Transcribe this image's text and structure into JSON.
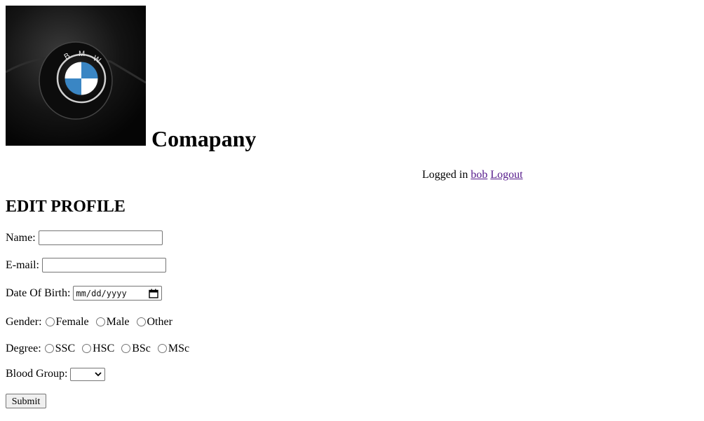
{
  "header": {
    "logo_icon": "bmw-steering-logo",
    "company_name": "Comapany"
  },
  "login": {
    "prefix": "Logged in",
    "username": "bob",
    "logout_label": "Logout"
  },
  "page": {
    "title": "EDIT PROFILE"
  },
  "form": {
    "name_label": "Name:",
    "name_value": "",
    "email_label": "E-mail:",
    "email_value": "",
    "dob_label": "Date Of Birth:",
    "dob_placeholder": "mm/dd/yyyy",
    "gender_label": "Gender:",
    "gender_options": [
      "Female",
      "Male",
      "Other"
    ],
    "degree_label": "Degree:",
    "degree_options": [
      "SSC",
      "HSC",
      "BSc",
      "MSc"
    ],
    "blood_group_label": "Blood Group:",
    "blood_group_value": "",
    "submit_label": "Submit"
  },
  "colors": {
    "link_visited": "#551a8b",
    "control_border": "#767676"
  }
}
